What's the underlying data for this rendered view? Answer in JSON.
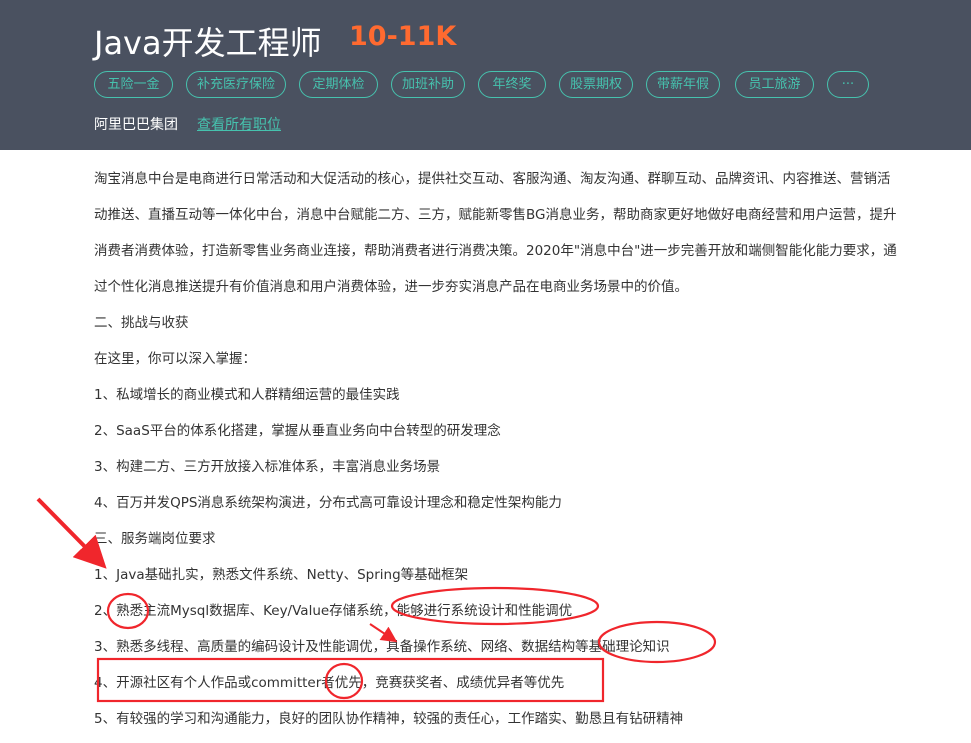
{
  "header": {
    "job_title": "Java开发工程师",
    "salary": "10-11K",
    "tags": [
      "五险一金",
      "补充医疗保险",
      "定期体检",
      "加班补助",
      "年终奖",
      "股票期权",
      "带薪年假",
      "员工旅游",
      "···"
    ],
    "company": "阿里巴巴集团",
    "all_jobs_link": "查看所有职位"
  },
  "description": {
    "lines": [
      "淘宝消息中台是电商进行日常活动和大促活动的核心，提供社交互动、客服沟通、淘友沟通、群聊互动、品牌资讯、内容推送、营销活",
      "动推送、直播互动等一体化中台，消息中台赋能二方、三方，赋能新零售BG消息业务，帮助商家更好地做好电商经营和用户运营，提升",
      "消费者消费体验，打造新零售业务商业连接，帮助消费者进行消费决策。2020年\"消息中台\"进一步完善开放和端侧智能化能力要求，通",
      "过个性化消息推送提升有价值消息和用户消费体验，进一步夯实消息产品在电商业务场景中的价值。",
      "二、挑战与收获",
      "在这里，你可以深入掌握：",
      "1、私域增长的商业模式和人群精细运营的最佳实践",
      "2、SaaS平台的体系化搭建，掌握从垂直业务向中台转型的研发理念",
      "3、构建二方、三方开放接入标准体系，丰富消息业务场景",
      "4、百万并发QPS消息系统架构演进，分布式高可靠设计理念和稳定性架构能力",
      "三、服务端岗位要求",
      "1、Java基础扎实，熟悉文件系统、Netty、Spring等基础框架",
      "2、熟悉主流Mysql数据库、Key/Value存储系统，能够进行系统设计和性能调优",
      "3、熟悉多线程、高质量的编码设计及性能调优，具备操作系统、网络、数据结构等基础理论知识",
      "4、开源社区有个人作品或committer者优先，竞赛获奖者、成绩优异者等优先",
      "5、有较强的学习和沟通能力，良好的团队协作精神，较强的责任心，工作踏实、勤恳且有钻研精神"
    ]
  },
  "annotations": {
    "color": "#f0262c"
  }
}
